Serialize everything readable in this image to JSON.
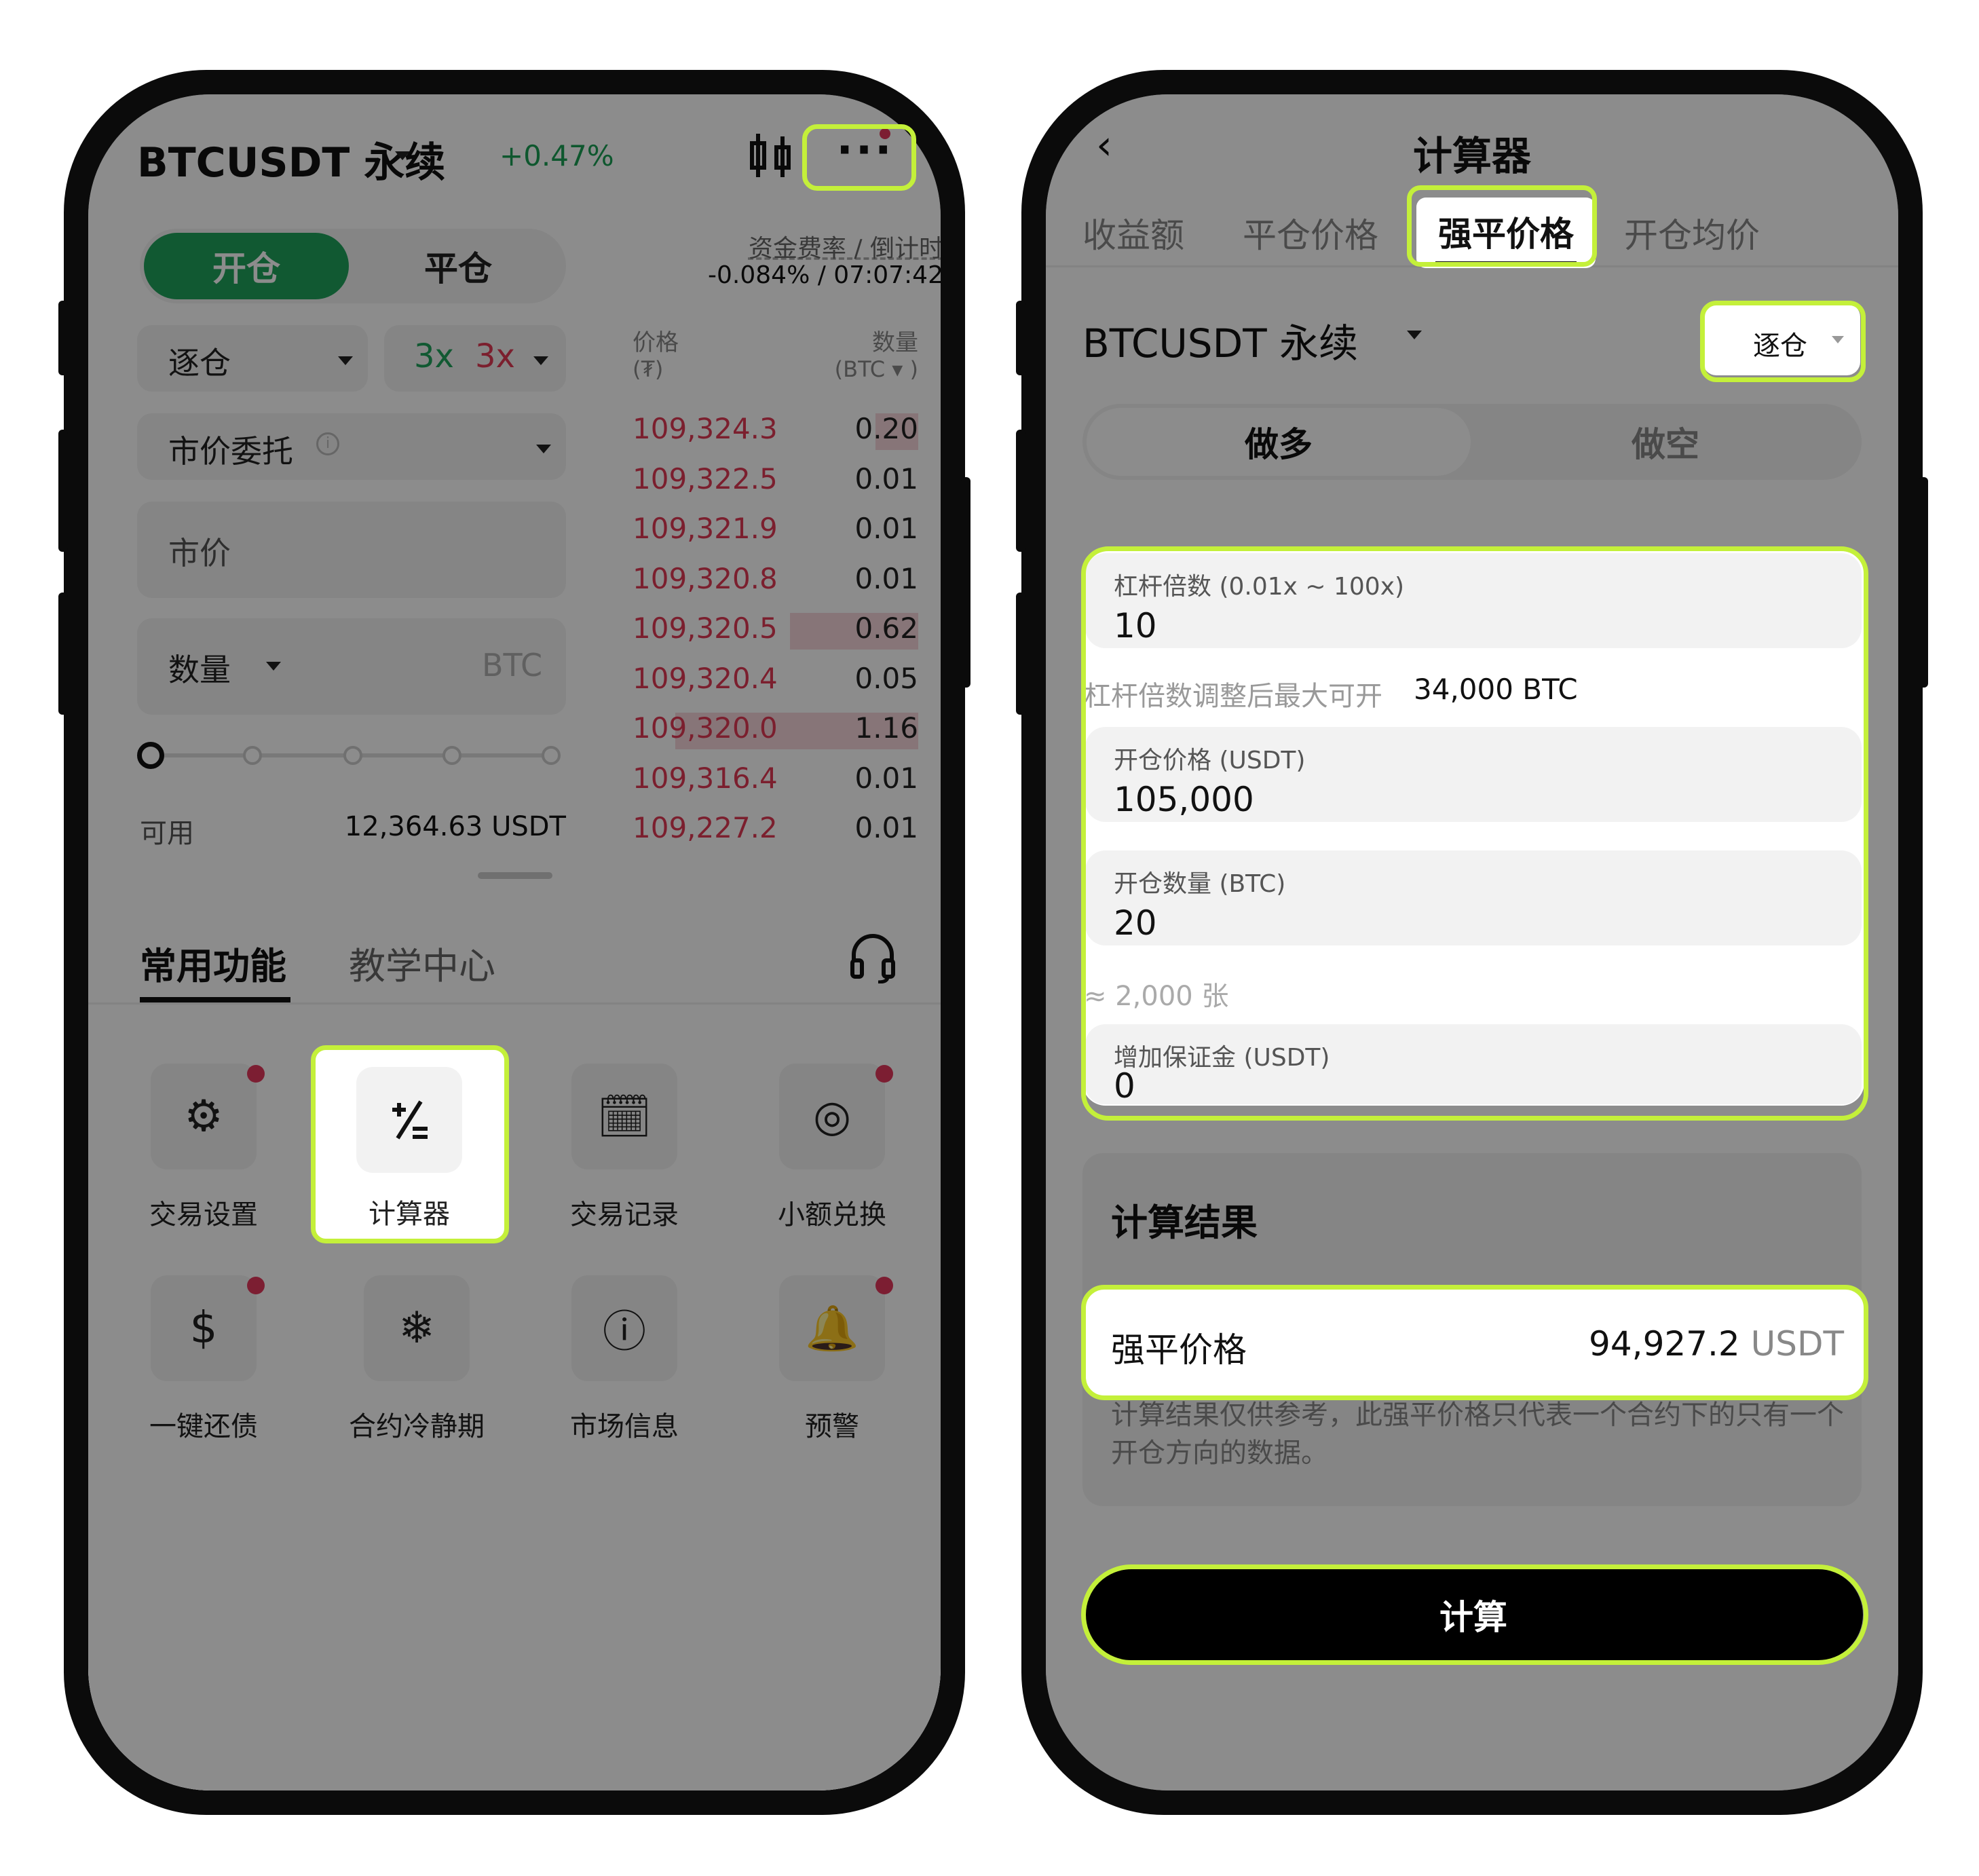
{
  "left": {
    "pair": "BTCUSDT 永续",
    "change": "+0.47%",
    "tabs": {
      "open": "开仓",
      "close": "平仓"
    },
    "funding_label": "资金费率 / 倒计时",
    "funding_value": "-0.084% / 07:07:42",
    "margin_mode": "逐仓",
    "leverage_long": "3x",
    "leverage_short": "3x",
    "order_type": "市价委托",
    "price_placeholder": "市价",
    "qty_label": "数量",
    "qty_unit": "BTC",
    "available_label": "可用",
    "available_value": "12,364.63 USDT",
    "orderbook": {
      "price_header": "价格",
      "price_unit": "(₮)",
      "qty_header": "数量",
      "qty_unit": "(BTC ▾ )",
      "rows": [
        {
          "price": "109,324.3",
          "qty": "0.20",
          "depth": 0.15
        },
        {
          "price": "109,322.5",
          "qty": "0.01",
          "depth": 0
        },
        {
          "price": "109,321.9",
          "qty": "0.01",
          "depth": 0
        },
        {
          "price": "109,320.8",
          "qty": "0.01",
          "depth": 0
        },
        {
          "price": "109,320.5",
          "qty": "0.62",
          "depth": 0.45
        },
        {
          "price": "109,320.4",
          "qty": "0.05",
          "depth": 0
        },
        {
          "price": "109,320.0",
          "qty": "1.16",
          "depth": 0.85
        },
        {
          "price": "109,316.4",
          "qty": "0.01",
          "depth": 0
        },
        {
          "price": "109,227.2",
          "qty": "0.01",
          "depth": 0
        }
      ]
    },
    "sheet": {
      "tab_common": "常用功能",
      "tab_learn": "教学中心",
      "functions": [
        {
          "label": "交易设置",
          "icon": "gear-icon",
          "glyph": "⚙"
        },
        {
          "label": "计算器",
          "icon": "calculator-icon",
          "glyph": "⁺∕₌"
        },
        {
          "label": "交易记录",
          "icon": "trade-record-icon",
          "glyph": "🗓"
        },
        {
          "label": "小额兑换",
          "icon": "small-exchange-icon",
          "glyph": "◎"
        },
        {
          "label": "一键还债",
          "icon": "repay-icon",
          "glyph": "$"
        },
        {
          "label": "合约冷静期",
          "icon": "snowflake-icon",
          "glyph": "❄"
        },
        {
          "label": "市场信息",
          "icon": "info-icon",
          "glyph": "ⓘ"
        },
        {
          "label": "预警",
          "icon": "bell-icon",
          "glyph": "🔔"
        }
      ]
    }
  },
  "right": {
    "title": "计算器",
    "tabs": [
      "收益额",
      "平仓价格",
      "强平价格",
      "开仓均价"
    ],
    "pair": "BTCUSDT 永续",
    "margin_mode": "逐仓",
    "side_long": "做多",
    "side_short": "做空",
    "fields": {
      "leverage_label": "杠杆倍数 (0.01x ~ 100x)",
      "leverage_value": "10",
      "max_open_label": "杠杆倍数调整后最大可开",
      "max_open_value": "34,000 BTC",
      "entry_price_label": "开仓价格 (USDT)",
      "entry_price_value": "105,000",
      "qty_label": "开仓数量 (BTC)",
      "qty_value": "20",
      "contracts_note": "≈ 2,000 张",
      "margin_label": "增加保证金 (USDT)",
      "margin_value": "0"
    },
    "result": {
      "heading": "计算结果",
      "liq_label": "强平价格",
      "liq_value": "94,927.2",
      "liq_unit": "USDT",
      "note": "计算结果仅供参考，此强平价格只代表一个合约下的只有一个开仓方向的数据。"
    },
    "calc_button": "计算"
  },
  "colors": {
    "highlight": "#c4f03a",
    "green": "#1fa35c",
    "red": "#e03a55"
  }
}
